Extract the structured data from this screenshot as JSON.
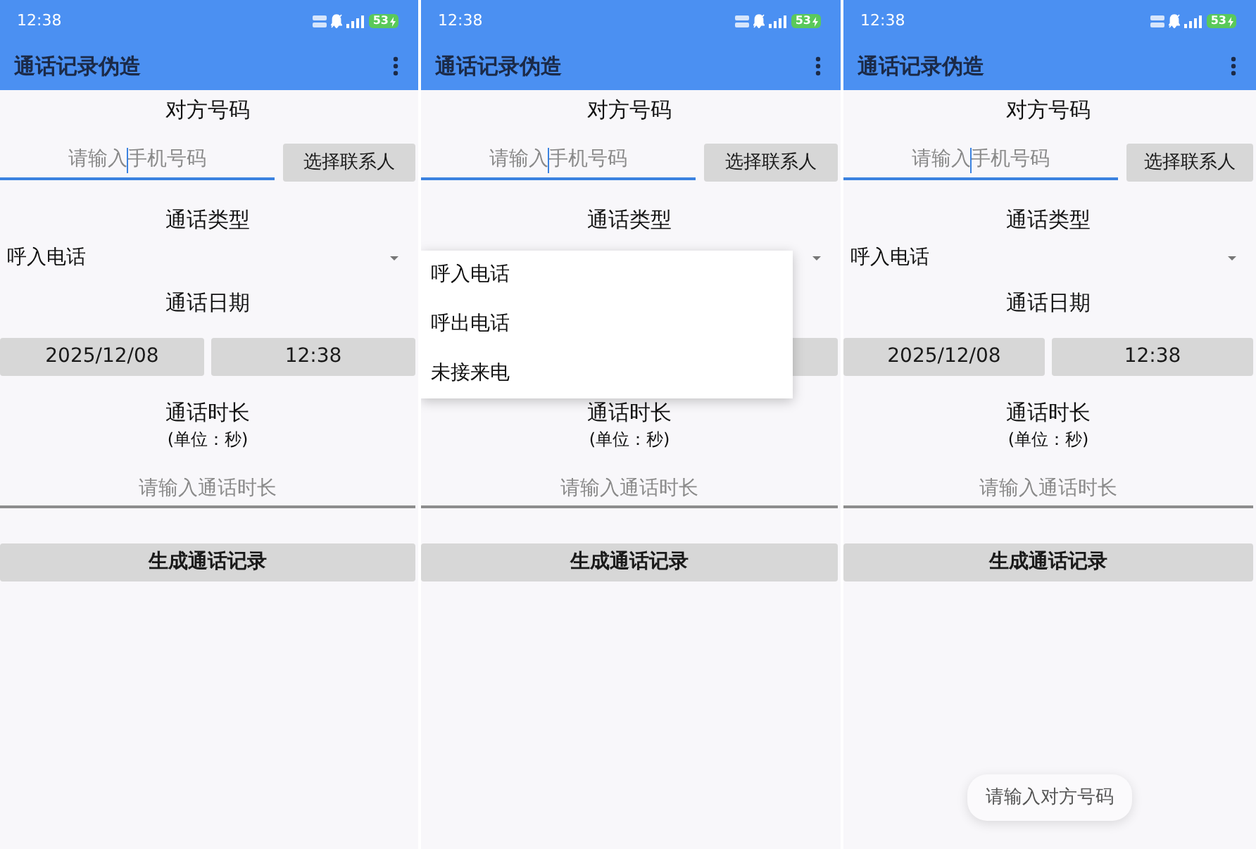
{
  "panels": [
    {
      "status_bar": {
        "time": "12:38",
        "battery": "53"
      },
      "app_bar": {
        "title": "通话记录伪造"
      },
      "form": {
        "number_label": "对方号码",
        "number_field": {
          "placeholder": "请输入手机号码",
          "focused": true
        },
        "contact_button": "选择联系人",
        "type_label": "通话类型",
        "type_value": "呼入电话",
        "date_label": "通话日期",
        "date_button": "2025/12/08",
        "time_button": "12:38",
        "duration_label": "通话时长",
        "duration_unit": "(单位：秒)",
        "duration_field": {
          "placeholder": "请输入通话时长",
          "focused": false
        },
        "generate_button": "生成通话记录"
      }
    },
    {
      "status_bar": {
        "time": "12:38",
        "battery": "53"
      },
      "app_bar": {
        "title": "通话记录伪造"
      },
      "form": {
        "number_label": "对方号码",
        "number_field": {
          "placeholder": "请输入手机号码",
          "focused": true
        },
        "contact_button": "选择联系人",
        "type_label": "通话类型",
        "duration_label": "通话时长",
        "duration_unit": "(单位：秒)",
        "duration_field": {
          "placeholder": "请输入通话时长",
          "focused": false
        },
        "generate_button": "生成通话记录"
      },
      "dropdown_menu": {
        "items": [
          {
            "label": "呼入电话",
            "selected": false
          },
          {
            "label": "呼出电话",
            "selected": false
          },
          {
            "label": "未接来电",
            "selected": false
          }
        ]
      }
    },
    {
      "status_bar": {
        "time": "12:38",
        "battery": "53"
      },
      "app_bar": {
        "title": "通话记录伪造"
      },
      "form": {
        "number_label": "对方号码",
        "number_field": {
          "placeholder": "请输入手机号码",
          "focused": true
        },
        "contact_button": "选择联系人",
        "type_label": "通话类型",
        "type_value": "呼入电话",
        "date_label": "通话日期",
        "date_button": "2025/12/08",
        "time_button": "12:38",
        "duration_label": "通话时长",
        "duration_unit": "(单位：秒)",
        "duration_field": {
          "placeholder": "请输入通话时长",
          "focused": false
        },
        "generate_button": "生成通话记录"
      },
      "toast": "请输入对方号码"
    }
  ]
}
